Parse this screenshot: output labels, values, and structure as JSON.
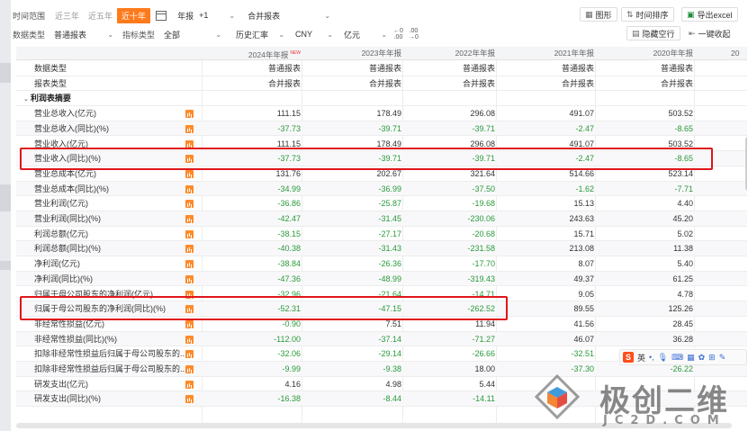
{
  "toolbar": {
    "time_range_label": "时间范围",
    "time_options": [
      "近三年",
      "近五年",
      "近十年"
    ],
    "time_active_index": 2,
    "period_select": "年报",
    "plus_select": "+1",
    "report_type_select": "合并报表",
    "buttons": {
      "chart": "图形",
      "time_sort": "时间排序",
      "export": "导出excel",
      "hide_empty": "隐藏空行",
      "collapse": "一键收起"
    },
    "data_type_label": "数据类型",
    "data_type_value": "普通报表",
    "indicator_label": "指标类型",
    "indicator_value": "全部",
    "fx_value": "历史汇率",
    "currency_value": "CNY",
    "unit_value": "亿元",
    "decimals": [
      "←0",
      ".00",
      ".00",
      "→0"
    ]
  },
  "table": {
    "columns": [
      "2024年年报",
      "2023年年报",
      "2022年年报",
      "2021年年报",
      "2020年年报",
      "20"
    ],
    "new_badge": "NEW",
    "meta_rows": [
      {
        "label": "数据类型",
        "values": [
          "普通报表",
          "普通报表",
          "普通报表",
          "普通报表",
          "普通报表"
        ]
      },
      {
        "label": "报表类型",
        "values": [
          "合并报表",
          "合并报表",
          "合并报表",
          "合并报表",
          "合并报表"
        ]
      }
    ],
    "section_title": "利润表摘要",
    "rows": [
      {
        "label": "营业总收入(亿元)",
        "values": [
          "111.15",
          "178.49",
          "296.08",
          "491.07",
          "503.52"
        ]
      },
      {
        "label": "营业总收入(同比)(%)",
        "values": [
          "-37.73",
          "-39.71",
          "-39.71",
          "-2.47",
          "-8.65"
        ]
      },
      {
        "label": "营业收入(亿元)",
        "values": [
          "111.15",
          "178.49",
          "296.08",
          "491.07",
          "503.52"
        ]
      },
      {
        "label": "营业收入(同比)(%)",
        "values": [
          "-37.73",
          "-39.71",
          "-39.71",
          "-2.47",
          "-8.65"
        ]
      },
      {
        "label": "营业总成本(亿元)",
        "values": [
          "131.76",
          "202.67",
          "321.64",
          "514.66",
          "523.14"
        ]
      },
      {
        "label": "营业总成本(同比)(%)",
        "values": [
          "-34.99",
          "-36.99",
          "-37.50",
          "-1.62",
          "-7.71"
        ]
      },
      {
        "label": "营业利润(亿元)",
        "values": [
          "-36.86",
          "-25.87",
          "-19.68",
          "15.13",
          "4.40"
        ]
      },
      {
        "label": "营业利润(同比)(%)",
        "values": [
          "-42.47",
          "-31.45",
          "-230.06",
          "243.63",
          "45.20"
        ]
      },
      {
        "label": "利润总额(亿元)",
        "values": [
          "-38.15",
          "-27.17",
          "-20.68",
          "15.71",
          "5.02"
        ]
      },
      {
        "label": "利润总额(同比)(%)",
        "values": [
          "-40.38",
          "-31.43",
          "-231.58",
          "213.08",
          "11.38"
        ]
      },
      {
        "label": "净利润(亿元)",
        "values": [
          "-38.84",
          "-26.36",
          "-17.70",
          "8.07",
          "5.40"
        ]
      },
      {
        "label": "净利润(同比)(%)",
        "values": [
          "-47.36",
          "-48.99",
          "-319.43",
          "49.37",
          "61.25"
        ]
      },
      {
        "label": "归属于母公司股东的净利润(亿元)",
        "values": [
          "-32.96",
          "-21.64",
          "-14.71",
          "9.05",
          "4.78"
        ]
      },
      {
        "label": "归属于母公司股东的净利润(同比)(%)",
        "values": [
          "-52.31",
          "-47.15",
          "-262.52",
          "89.55",
          "125.26"
        ]
      },
      {
        "label": "非经常性损益(亿元)",
        "values": [
          "-0.90",
          "7.51",
          "11.94",
          "41.56",
          "28.45"
        ]
      },
      {
        "label": "非经常性损益(同比)(%)",
        "values": [
          "-112.00",
          "-37.14",
          "-71.27",
          "46.07",
          "36.28"
        ]
      },
      {
        "label": "扣除非经常性损益后归属于母公司股东的...",
        "values": [
          "-32.06",
          "-29.14",
          "-26.66",
          "-32.51",
          ""
        ]
      },
      {
        "label": "扣除非经常性损益后归属于母公司股东的...",
        "values": [
          "-9.99",
          "-9.38",
          "18.00",
          "-37.30",
          "-26.22"
        ]
      },
      {
        "label": "研发支出(亿元)",
        "values": [
          "4.16",
          "4.98",
          "5.44",
          "",
          ""
        ]
      },
      {
        "label": "研发支出(同比)(%)",
        "values": [
          "-16.38",
          "-8.44",
          "-14.11",
          "",
          ""
        ]
      }
    ]
  },
  "ime_bar": {
    "logo": "S",
    "lang": "英"
  },
  "watermark": {
    "cn": "极创二维",
    "en": "JC2D.COM"
  }
}
